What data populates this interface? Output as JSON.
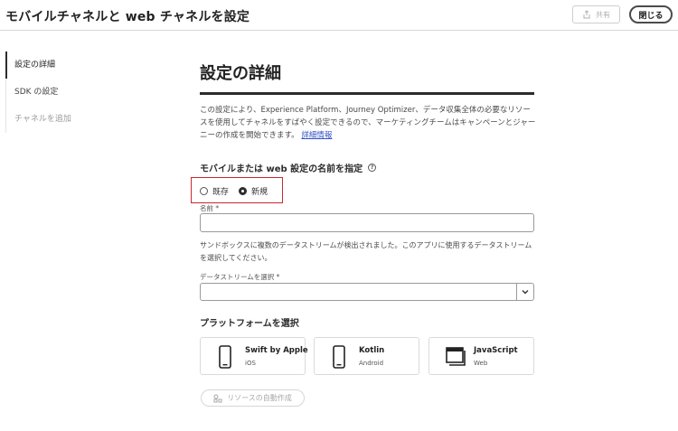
{
  "header": {
    "title": "モバイルチャネルと web チャネルを設定",
    "share_label": "共有",
    "close_label": "閉じる"
  },
  "sidebar": {
    "items": [
      {
        "label": "設定の詳細",
        "state": "active"
      },
      {
        "label": "SDK の設定",
        "state": "normal"
      },
      {
        "label": "チャネルを追加",
        "state": "disabled"
      }
    ]
  },
  "main": {
    "title": "設定の詳細",
    "description": "この設定により、Experience Platform、Journey Optimizer、データ収集全体の必要なリソースを使用してチャネルをすばやく設定できるので、マーケティングチームはキャンペーンとジャーニーの作成を開始できます。",
    "learn_more": "詳細情報",
    "name_section_label": "モバイルまたは web 設定の名前を指定",
    "radio_existing": "既存",
    "radio_new": "新規",
    "radio_selected": "新規",
    "name_label": "名前 *",
    "name_value": "",
    "notice": "サンドボックスに複数のデータストリームが検出されました。このアプリに使用するデータストリームを選択してください。",
    "datastream_label": "データストリームを選択 *",
    "datastream_value": "",
    "platform_heading": "プラットフォームを選択",
    "platforms": [
      {
        "name": "Swift by Apple",
        "sub": "iOS",
        "icon": "phone-icon"
      },
      {
        "name": "Kotlin",
        "sub": "Android",
        "icon": "phone-icon"
      },
      {
        "name": "JavaScript",
        "sub": "Web",
        "icon": "browser-window-icon"
      }
    ],
    "auto_create_label": "リソースの自動作成"
  },
  "colors": {
    "highlight_box": "#c8282f",
    "link": "#3553c7",
    "text": "#2c2c2c"
  }
}
